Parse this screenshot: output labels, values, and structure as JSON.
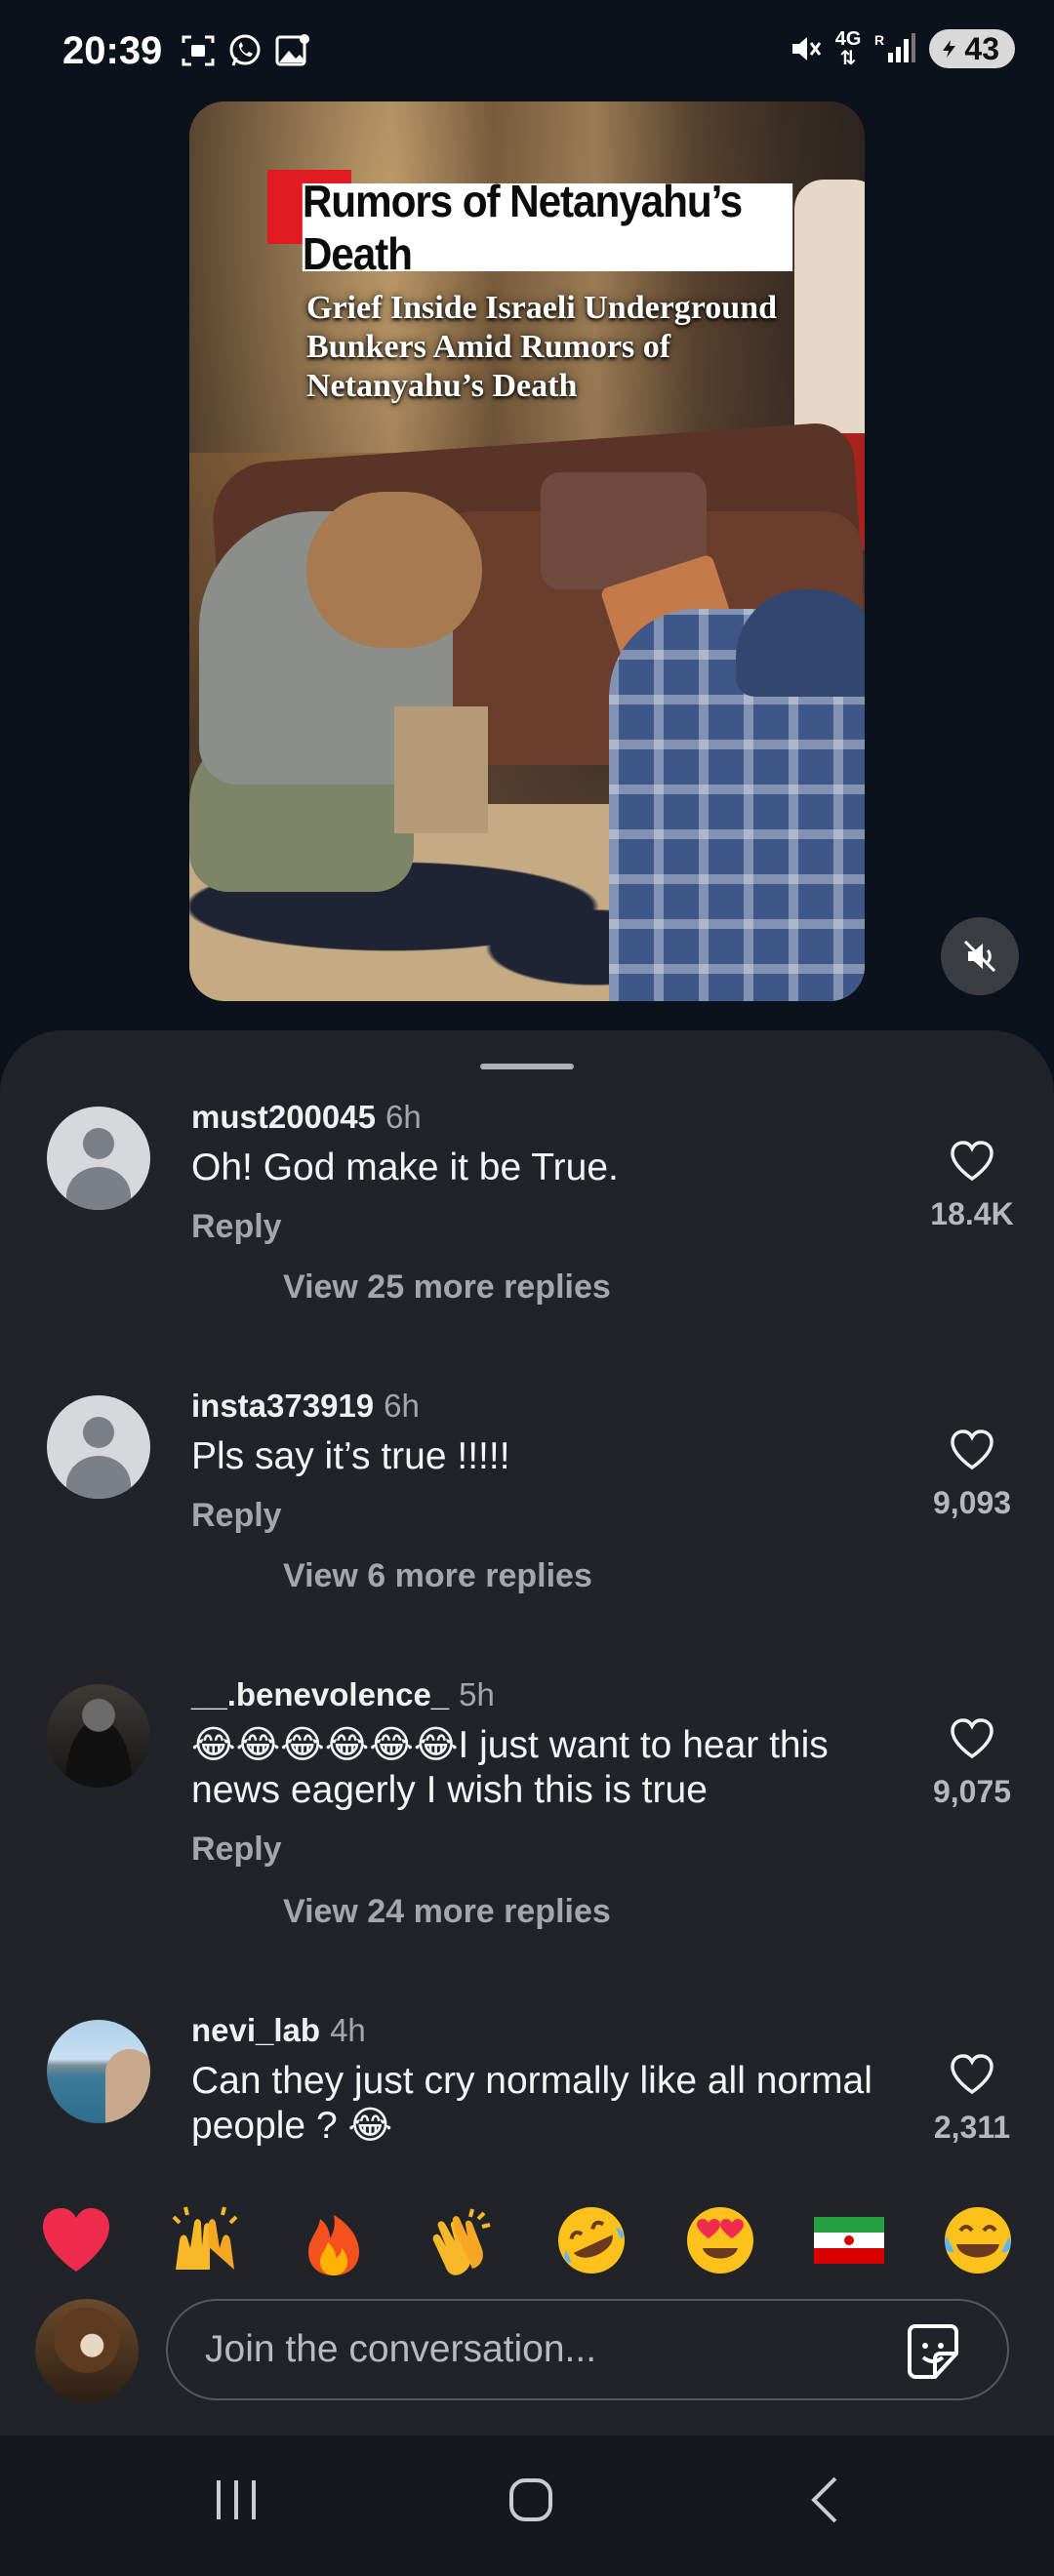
{
  "status_bar": {
    "time": "20:39",
    "network": "4G",
    "network_sub": "R",
    "battery": "43",
    "icons_left": [
      "screenshot-icon",
      "whatsapp-icon",
      "photo-icon"
    ],
    "icons_right": [
      "mute-icon",
      "network-icon",
      "signal-icon",
      "battery-icon"
    ]
  },
  "video": {
    "headline": "Rumors of Netanyahu’s Death",
    "subheadline": "Grief Inside Israeli Underground Bunkers Amid Rumors of Netanyahu’s Death",
    "muted_icon": "speaker-mute-icon"
  },
  "comments": [
    {
      "user": "must200045",
      "time": "6h",
      "text": "Oh! God make it be True.",
      "reply": "Reply",
      "likes": "18.4K",
      "more_replies": "View 25 more replies",
      "avatar": "default-avatar"
    },
    {
      "user": "insta373919",
      "time": "6h",
      "text": "Pls say it’s true !!!!!",
      "reply": "Reply",
      "likes": "9,093",
      "more_replies": "View 6 more replies",
      "avatar": "default-avatar"
    },
    {
      "user": "__.benevolence_",
      "time": "5h",
      "emoji_prefix": "😂😂😂😂😂😂",
      "text": "I just want to hear this news eagerly I wish this is true",
      "reply": "Reply",
      "likes": "9,075",
      "more_replies": "View 24 more replies",
      "avatar": "photo-avatar"
    },
    {
      "user": "nevi_lab",
      "time": "4h",
      "text": "Can they just cry normally like all normal people ? 😂",
      "likes": "2,311",
      "avatar": "photo-avatar"
    }
  ],
  "emoji_bar": [
    "heart",
    "raised-hands",
    "fire",
    "clapping-hands",
    "rofl",
    "heart-eyes",
    "iran-flag",
    "tears-of-joy"
  ],
  "composer": {
    "placeholder": "Join the conversation...",
    "sticker_icon": "sticker-icon"
  },
  "nav_bar": [
    "recents-icon",
    "home-icon",
    "back-icon"
  ],
  "colors": {
    "background": "#0c121b",
    "sheet": "#202328",
    "muted_text": "#a3a7ad",
    "title_accent": "#e11b22"
  }
}
